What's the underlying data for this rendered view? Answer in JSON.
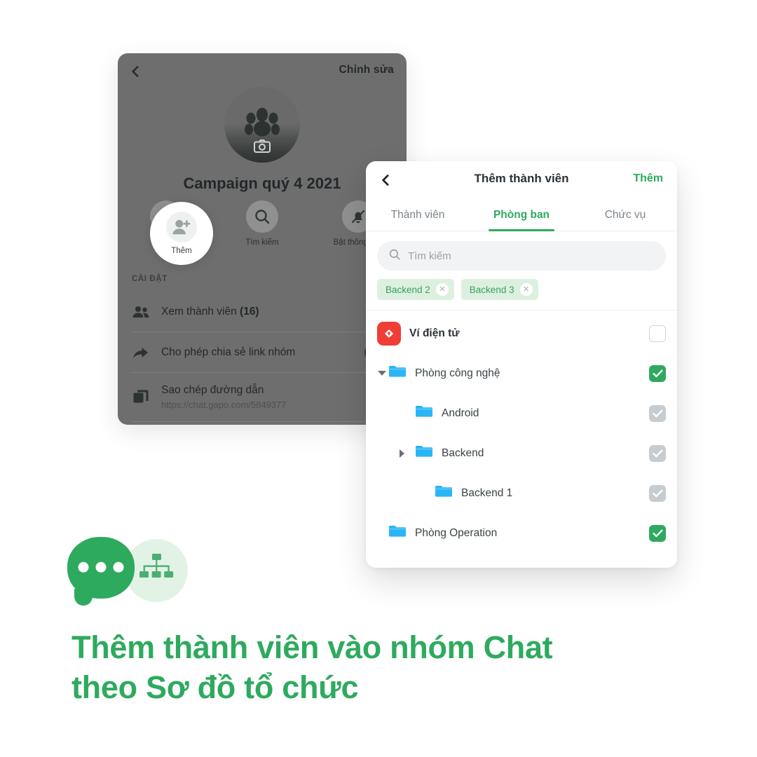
{
  "back_panel": {
    "back_icon": "chevron-left-icon",
    "edit_label": "Chỉnh sửa",
    "avatar_icon": "group-avatar-icon",
    "camera_icon": "camera-icon",
    "group_title": "Campaign quý 4 2021",
    "actions": [
      {
        "icon": "add-member-icon",
        "label": "Thêm"
      },
      {
        "icon": "search-icon",
        "label": "Tìm kiếm"
      },
      {
        "icon": "bell-off-icon",
        "label": "Bật thông báo"
      }
    ],
    "section_header": "CÀI ĐẶT",
    "rows": [
      {
        "icon": "members-icon",
        "label": "Xem thành viên",
        "count": "(16)"
      },
      {
        "icon": "share-arrow-icon",
        "label": "Cho phép chia sẻ link nhóm",
        "toggle": "on"
      },
      {
        "icon": "copy-icon",
        "label": "Sao chép đường dẫn",
        "sub": "https://chat.gapo.com/5849377"
      }
    ]
  },
  "modal": {
    "back_icon": "chevron-left-icon",
    "title": "Thêm thành viên",
    "action_label": "Thêm",
    "tabs": [
      {
        "label": "Thành viên",
        "active": false
      },
      {
        "label": "Phòng ban",
        "active": true
      },
      {
        "label": "Chức vụ",
        "active": false
      }
    ],
    "search": {
      "icon": "search-icon",
      "placeholder": "Tìm kiếm",
      "value": ""
    },
    "chips": [
      {
        "label": "Backend 2",
        "remove_icon": "close-icon"
      },
      {
        "label": "Backend 3",
        "remove_icon": "close-icon"
      }
    ],
    "tree": [
      {
        "label": "Ví điện tử",
        "icon": "app-wallet-icon",
        "indent": 0,
        "caret": "none",
        "checkbox": "empty",
        "bold": true
      },
      {
        "label": "Phòng công nghệ",
        "icon": "folder-icon",
        "indent": 0,
        "caret": "down",
        "checkbox": "checked",
        "bold": false
      },
      {
        "label": "Android",
        "icon": "folder-icon",
        "indent": 1,
        "caret": "none",
        "checkbox": "dimmed",
        "bold": false
      },
      {
        "label": "Backend",
        "icon": "folder-icon",
        "indent": 1,
        "caret": "right",
        "checkbox": "dimmed",
        "bold": false
      },
      {
        "label": "Backend 1",
        "icon": "folder-icon",
        "indent": 2,
        "caret": "none",
        "checkbox": "dimmed",
        "bold": false
      },
      {
        "label": "Phòng Operation",
        "icon": "folder-icon",
        "indent": 0,
        "caret": "none",
        "checkbox": "checked",
        "bold": false
      }
    ]
  },
  "branding": {
    "chat_bubble_icon": "chat-bubble-icon",
    "org_chart_icon": "org-chart-icon",
    "headline_line1": "Thêm thành viên vào nhóm Chat",
    "headline_line2": "theo Sơ đồ tổ chức"
  },
  "colors": {
    "green": "#2eaa5e",
    "green_light": "#ddf0e0",
    "folder_blue": "#29b6f6",
    "app_red": "#ef3e36",
    "panel_dim": "#6e6e6e"
  }
}
